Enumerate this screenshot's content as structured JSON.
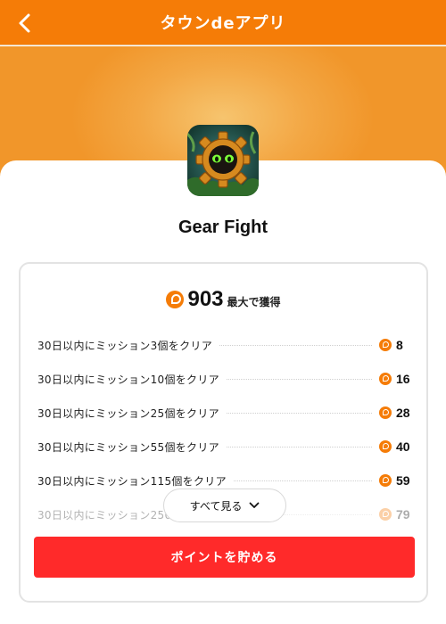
{
  "header": {
    "title": "タウンdeアプリ",
    "back_icon": "chevron-left-icon"
  },
  "app": {
    "name": "Gear Fight",
    "icon": "gear-creature-app-icon"
  },
  "points": {
    "total": "903",
    "suffix": "最大で獲得",
    "coin_icon": "point-coin-icon"
  },
  "missions": [
    {
      "label": "30日以内にミッション3個をクリア",
      "points": "8"
    },
    {
      "label": "30日以内にミッション10個をクリア",
      "points": "16"
    },
    {
      "label": "30日以内にミッション25個をクリア",
      "points": "28"
    },
    {
      "label": "30日以内にミッション55個をクリア",
      "points": "40"
    },
    {
      "label": "30日以内にミッション115個をクリア",
      "points": "59"
    },
    {
      "label": "30日以内にミッション250",
      "points": "79"
    }
  ],
  "see_all": {
    "label": "すべて見る"
  },
  "cta": {
    "label": "ポイントを貯める"
  },
  "colors": {
    "brand": "#f57c07",
    "cta": "#ff2a2a"
  }
}
